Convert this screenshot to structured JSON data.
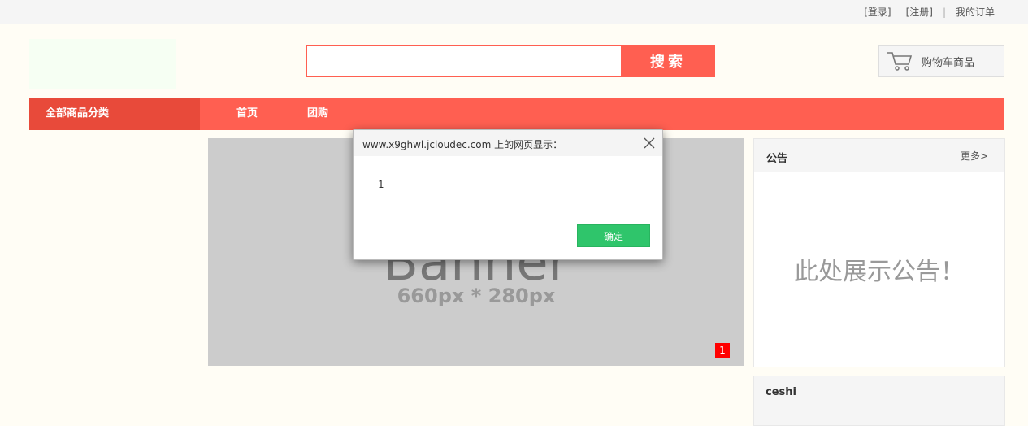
{
  "topbar": {
    "login": "[登录]",
    "register": "[注册]",
    "separator": "|",
    "orders": "我的订单"
  },
  "search": {
    "value": "",
    "placeholder": "",
    "button_label": "搜索"
  },
  "cart": {
    "label": "购物车商品",
    "icon": "cart-icon"
  },
  "nav": {
    "all_categories": "全部商品分类",
    "items": [
      "首页",
      "团购"
    ]
  },
  "banner": {
    "title": "Banner",
    "subtitle": "660px * 280px",
    "page_indicator": "1"
  },
  "notice": {
    "title": "公告",
    "more": "更多>",
    "body": "此处展示公告！"
  },
  "section2": {
    "title": "ceshi"
  },
  "dialog": {
    "title": "www.x9ghwl.jcloudec.com 上的网页显示：",
    "message": "1",
    "ok_label": "确定",
    "close_icon": "close-icon"
  },
  "colors": {
    "accent": "#ff5f51",
    "accent_dark": "#e84a3a",
    "ok_button": "#2fc56b",
    "banner_bg": "#cccccc",
    "page_bg": "#fffdf5",
    "indicator": "#ff0000"
  }
}
